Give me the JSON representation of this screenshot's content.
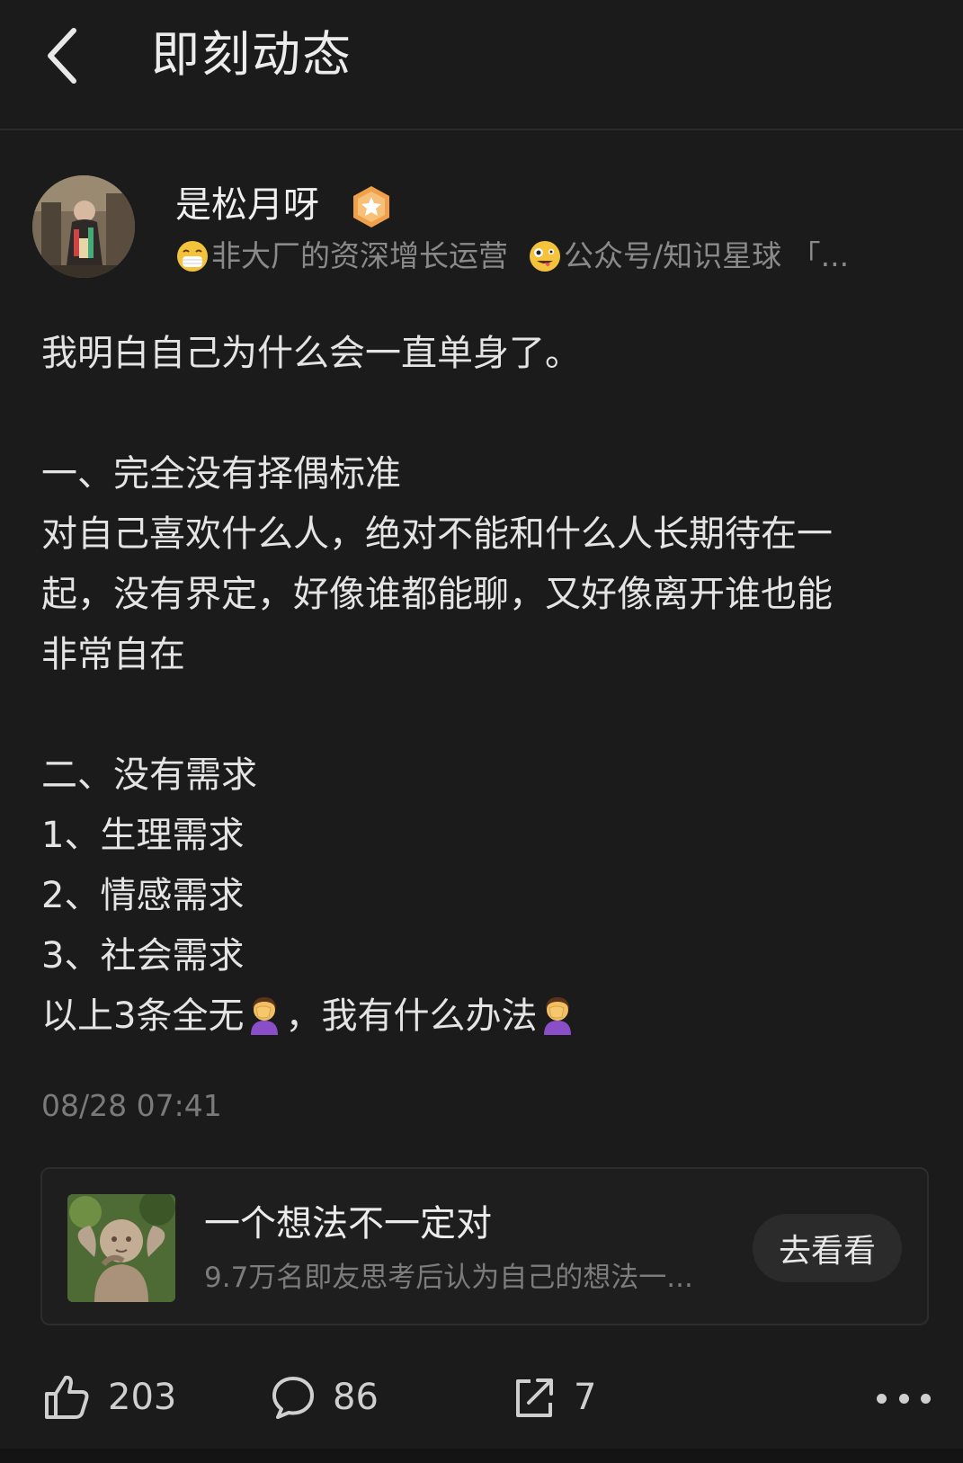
{
  "header": {
    "title": "即刻动态"
  },
  "author": {
    "name": "是松月呀",
    "badge_icon": "vip-star-badge",
    "bio_part1": "非大厂的资深增长运营",
    "bio_part2": "公众号/知识星球 「...",
    "bio_emoji1": "mask-face-emoji",
    "bio_emoji2": "zany-face-emoji"
  },
  "post": {
    "lines": [
      "我明白自己为什么会一直单身了。",
      "",
      "一、完全没有择偶标准",
      "对自己喜欢什么人，绝对不能和什么人长期待在一",
      "起，没有界定，好像谁都能聊，又好像离开谁也能",
      "非常自在",
      "",
      "二、没有需求",
      "1、生理需求",
      "2、情感需求",
      "3、社会需求"
    ],
    "last_line_a": "以上3条全无",
    "last_line_b": "，我有什么办法",
    "facepalm_emoji": "woman-facepalming-emoji",
    "timestamp": "08/28 07:41"
  },
  "topic_card": {
    "title": "一个想法不一定对",
    "subtitle": "9.7万名即友思考后认为自己的想法一...",
    "button_label": "去看看"
  },
  "actions": {
    "like_count": "203",
    "comment_count": "86",
    "share_count": "7"
  },
  "colors": {
    "background": "#1b1b1c",
    "text_primary": "#e4e4e4",
    "text_secondary": "#8a8a8a",
    "badge": "#f0a04b"
  }
}
